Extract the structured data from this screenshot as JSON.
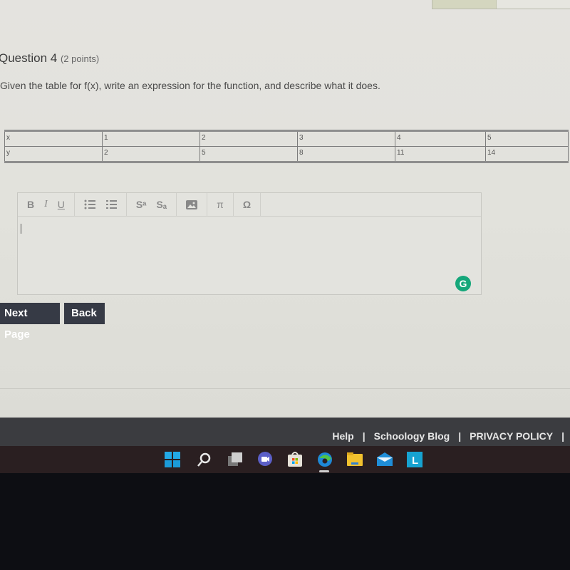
{
  "progress": {
    "fraction": 0.46
  },
  "question": {
    "title": "Question 4",
    "points": "(2 points)",
    "prompt": "Given the table for f(x), write an expression for the function, and describe what it does."
  },
  "table": {
    "rows": [
      {
        "label": "x",
        "values": [
          "1",
          "2",
          "3",
          "4",
          "5"
        ]
      },
      {
        "label": "y",
        "values": [
          "2",
          "5",
          "8",
          "11",
          "14"
        ]
      }
    ]
  },
  "editor": {
    "toolbar": {
      "bold": "B",
      "italic": "I",
      "underline": "U",
      "superscript": "Sᵃ",
      "subscript": "Sₐ",
      "pi": "π",
      "omega": "Ω"
    },
    "value": "",
    "grammarly": "G"
  },
  "buttons": {
    "next": "Next Page",
    "back": "Back"
  },
  "footer": {
    "links": [
      "Help",
      "Schoology Blog",
      "PRIVACY POLICY"
    ],
    "separator": "|"
  },
  "taskbar": {
    "icons": [
      "windows-start",
      "search",
      "task-view",
      "teams-chat",
      "microsoft-store",
      "edge",
      "file-explorer",
      "mail",
      "launcher-l"
    ]
  }
}
